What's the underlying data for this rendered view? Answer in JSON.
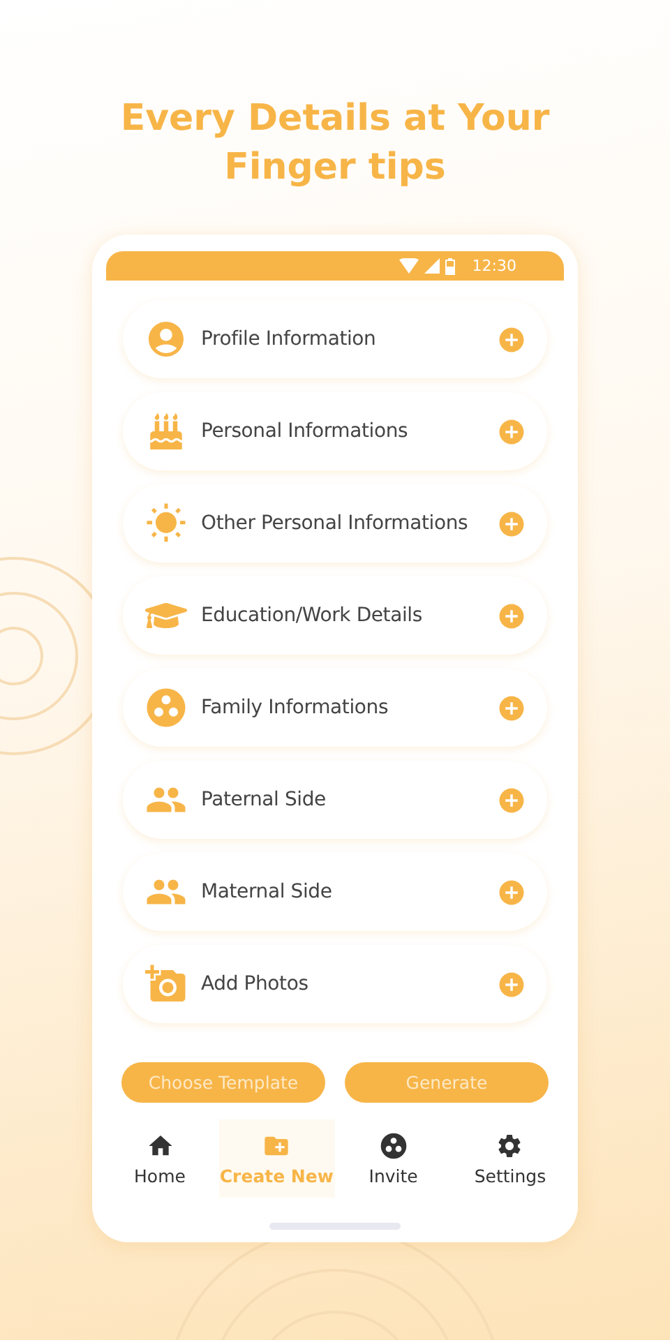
{
  "headline": "Every Details at Your Finger tips",
  "status_bar": {
    "time": "12:30"
  },
  "sections": [
    {
      "kind": "profile",
      "label": "Profile Information"
    },
    {
      "kind": "cake",
      "label": "Personal Informations"
    },
    {
      "kind": "sun",
      "label": "Other Personal Informations"
    },
    {
      "kind": "education",
      "label": "Education/Work Details"
    },
    {
      "kind": "family",
      "label": "Family Informations"
    },
    {
      "kind": "people",
      "label": "Paternal Side"
    },
    {
      "kind": "people",
      "label": "Maternal Side"
    },
    {
      "kind": "photo",
      "label": "Add Photos"
    }
  ],
  "buttons": [
    "Choose Template",
    "Generate"
  ],
  "nav": [
    {
      "kind": "home",
      "label": "Home",
      "selected": false
    },
    {
      "kind": "create",
      "label": "Create New",
      "selected": true
    },
    {
      "kind": "family",
      "label": "Invite",
      "selected": false
    },
    {
      "kind": "settings",
      "label": "Settings",
      "selected": false
    }
  ]
}
